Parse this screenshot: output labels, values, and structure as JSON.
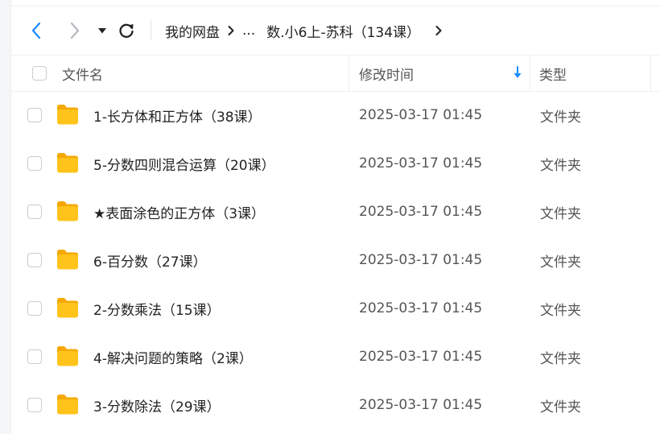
{
  "breadcrumb": {
    "root": "我的网盘",
    "ellipsis": "...",
    "current": "数.小6上-苏科（134课）"
  },
  "table": {
    "columns": {
      "name": "文件名",
      "time": "修改时间",
      "type": "类型"
    },
    "rows": [
      {
        "name": "1-长方体和正方体（38课）",
        "time": "2025-03-17 01:45",
        "type": "文件夹"
      },
      {
        "name": "5-分数四则混合运算（20课）",
        "time": "2025-03-17 01:45",
        "type": "文件夹"
      },
      {
        "name": "★表面涂色的正方体（3课）",
        "time": "2025-03-17 01:45",
        "type": "文件夹"
      },
      {
        "name": "6-百分数（27课）",
        "time": "2025-03-17 01:45",
        "type": "文件夹"
      },
      {
        "name": "2-分数乘法（15课）",
        "time": "2025-03-17 01:45",
        "type": "文件夹"
      },
      {
        "name": "4-解决问题的策略（2课）",
        "time": "2025-03-17 01:45",
        "type": "文件夹"
      },
      {
        "name": "3-分数除法（29课）",
        "time": "2025-03-17 01:45",
        "type": "文件夹"
      }
    ]
  },
  "icons": {
    "back": "chevron-left-icon",
    "forward": "chevron-right-icon",
    "dropdown": "caret-down-icon",
    "refresh": "refresh-icon",
    "sort": "arrow-down-icon",
    "folder": "folder-icon"
  },
  "colors": {
    "accent": "#1a8cff",
    "folder": "#ffc31a",
    "disabled": "#b6b9bf"
  }
}
